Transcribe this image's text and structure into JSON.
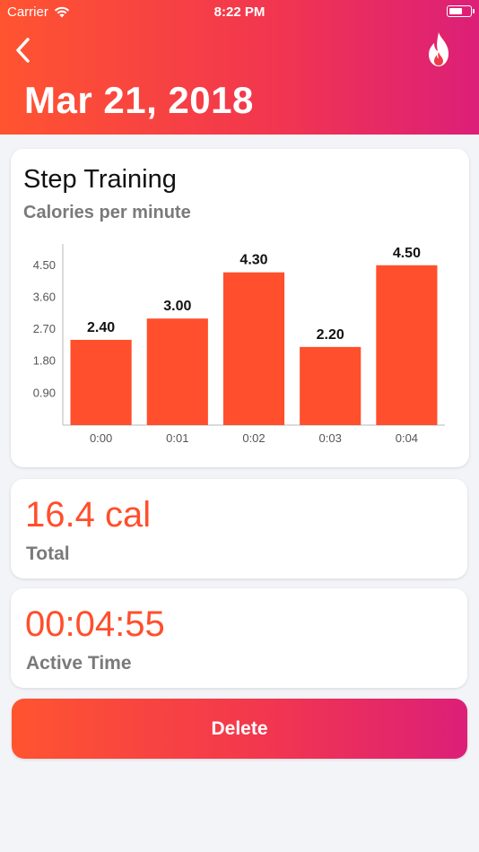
{
  "status_bar": {
    "carrier": "Carrier",
    "time": "8:22 PM"
  },
  "header": {
    "back_icon": "chevron-left-icon",
    "action_icon": "flame-icon",
    "title": "Mar 21, 2018"
  },
  "chart_card": {
    "title": "Step Training",
    "subtitle": "Calories per minute"
  },
  "chart_data": {
    "type": "bar",
    "title": "Step Training",
    "subtitle": "Calories per minute",
    "categories": [
      "0:00",
      "0:01",
      "0:02",
      "0:03",
      "0:04"
    ],
    "values": [
      2.4,
      3.0,
      4.3,
      2.2,
      4.5
    ],
    "value_labels": [
      "2.40",
      "3.00",
      "4.30",
      "2.20",
      "4.50"
    ],
    "y_ticks": [
      "0.90",
      "1.80",
      "2.70",
      "3.60",
      "4.50"
    ],
    "y_tick_values": [
      0.9,
      1.8,
      2.7,
      3.6,
      4.5
    ],
    "ylim": [
      0,
      5.1
    ],
    "xlabel": "",
    "ylabel": "",
    "grid": false,
    "bar_color": "#ff4f2c"
  },
  "stats": {
    "total_value": "16.4 cal",
    "total_label": "Total",
    "active_time_value": "00:04:55",
    "active_time_label": "Active Time"
  },
  "delete_label": "Delete",
  "colors": {
    "accent": "#ff4f2c",
    "gradient_start": "#ff5430",
    "gradient_end": "#dc1f78",
    "background": "#f3f4f8"
  }
}
